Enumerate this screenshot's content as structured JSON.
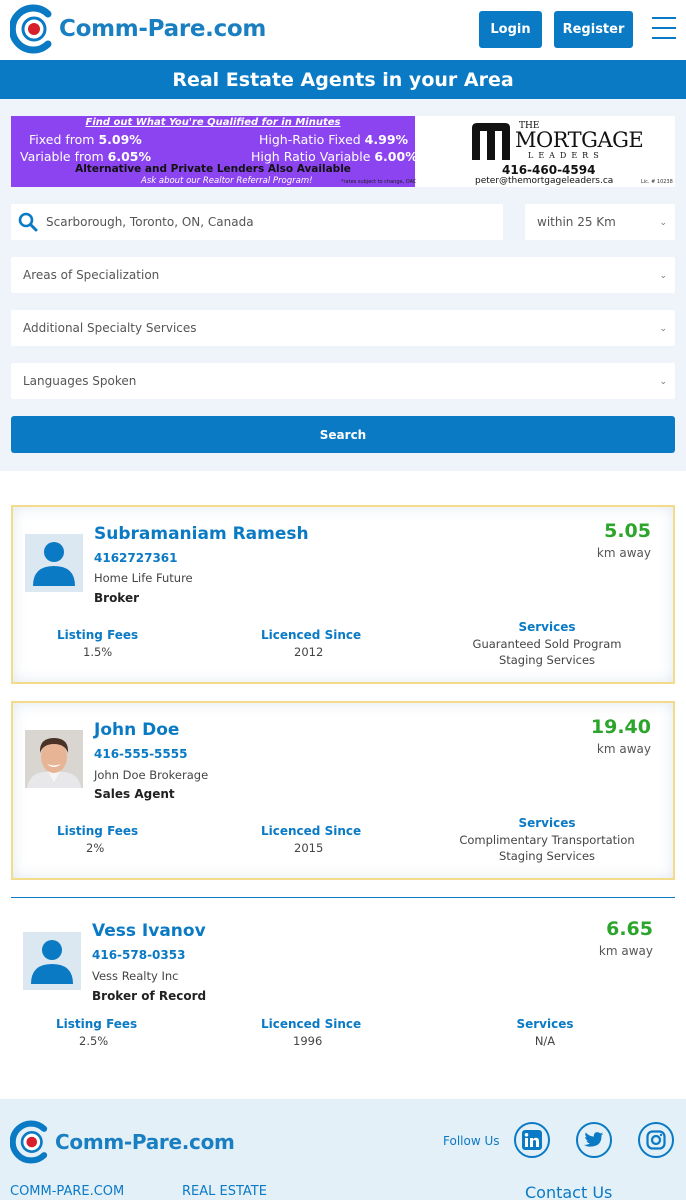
{
  "header": {
    "logo_text": "Comm-Pare.com",
    "login_label": "Login",
    "register_label": "Register"
  },
  "page_title": "Real Estate Agents in your Area",
  "banner": {
    "headline": "Find out What You're Qualified for in Minutes",
    "fixed_label": "Fixed from ",
    "fixed_rate": "5.09%",
    "hr_fixed_label": "High-Ratio Fixed ",
    "hr_fixed_rate": "4.99%",
    "variable_label": "Variable from ",
    "variable_rate": "6.05%",
    "hr_variable_label": "High Ratio Variable ",
    "hr_variable_rate": "6.00%",
    "alt_lenders": "Alternative and Private Lenders Also Available",
    "referral": "Ask about our Realtor Referral Program!",
    "fine_print": "*rates subject to change, OAC",
    "brand_the": "THE",
    "brand_name": "MORTGAGE",
    "brand_sub": "LEADERS",
    "phone": "416-460-4594",
    "email": "peter@themortgageleaders.ca",
    "license": "Lic. # 10238"
  },
  "search": {
    "location": "Scarborough, Toronto, ON, Canada",
    "radius": "within 25 Km",
    "specialization_placeholder": "Areas of Specialization",
    "services_placeholder": "Additional Specialty Services",
    "languages_placeholder": "Languages Spoken",
    "button_label": "Search"
  },
  "labels": {
    "km_away": "km away",
    "listing_fees": "Listing Fees",
    "licenced_since": "Licenced Since",
    "services": "Services"
  },
  "agents": [
    {
      "name": "Subramaniam Ramesh",
      "phone": "4162727361",
      "company": "Home Life Future",
      "role": "Broker",
      "distance": "5.05",
      "listing_fees": "1.5%",
      "licenced_since": "2012",
      "services": [
        "Guaranteed Sold Program",
        "Staging Services"
      ]
    },
    {
      "name": "John Doe",
      "phone": "416-555-5555",
      "company": "John Doe Brokerage",
      "role": "Sales Agent",
      "distance": "19.40",
      "listing_fees": "2%",
      "licenced_since": "2015",
      "services": [
        "Complimentary Transportation",
        "Staging Services"
      ]
    },
    {
      "name": "Vess Ivanov",
      "phone": "416-578-0353",
      "company": "Vess Realty Inc",
      "role": "Broker of Record",
      "distance": "6.65",
      "listing_fees": "2.5%",
      "licenced_since": "1996",
      "services": [
        "N/A"
      ]
    }
  ],
  "footer": {
    "logo_text": "Comm-Pare.com",
    "follow_us": "Follow Us",
    "link_company": "COMM-PARE.COM",
    "link_real_estate": "REAL ESTATE",
    "link_contact": "Contact Us"
  },
  "colors": {
    "brand_blue": "#0a7ac4",
    "logo_red": "#d6202c",
    "distance_green": "#2ca52c",
    "featured_border": "#f2dc8a",
    "banner_purple": "#8b44ef"
  }
}
